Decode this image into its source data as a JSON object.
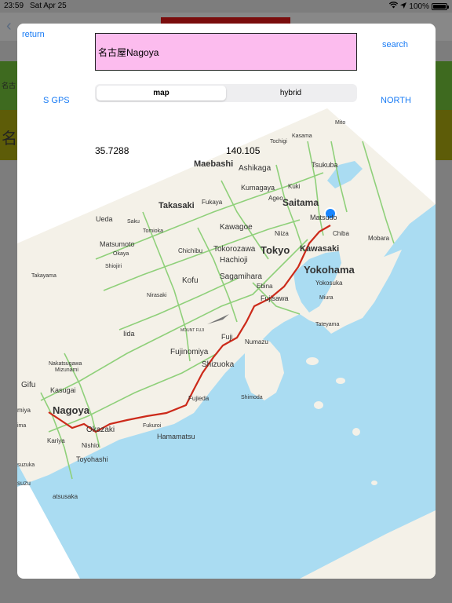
{
  "status_bar": {
    "time": "23:59",
    "date": "Sat Apr 25",
    "battery": "100%",
    "battery_level": 1.0
  },
  "background": {
    "row_small_text": "名古",
    "row_big_text": "名"
  },
  "toolbar": {
    "return_label": "return",
    "search_label": "search",
    "search_value": "名古屋Nagoya",
    "gps_label": "S GPS",
    "north_label": "NORTH"
  },
  "map_type": {
    "options": [
      "map",
      "hybrid"
    ],
    "selected": "map"
  },
  "coordinates": {
    "latitude": "35.7288",
    "longitude": "140.105"
  },
  "map": {
    "colors": {
      "land": "#f4f1e8",
      "water": "#aadcf2",
      "route": "#cc2a1a",
      "location": "#1a86ff"
    },
    "labels": {
      "mito": "Mito",
      "maebashi": "Maebashi",
      "ashikaga": "Ashikaga",
      "tochigi": "Tochigi",
      "kasama": "Kasama",
      "kumagaya": "Kumagaya",
      "takasaki": "Takasaki",
      "fukaya": "Fukaya",
      "tsukuba": "Tsukuba",
      "kuki": "Kuki",
      "saitama": "Saitama",
      "ageo": "Ageo",
      "ueda": "Ueda",
      "saku": "Saku",
      "tomioka": "Tomioka",
      "matsumoto": "Matsumoto",
      "kawagoe": "Kawagoe",
      "matsudo": "Matsudo",
      "tokorozawa": "Tokorozawa",
      "niiza": "Niiza",
      "chiba": "Chiba",
      "chichibu": "Chichibu",
      "hachioji": "Hachioji",
      "tokyo": "Tokyo",
      "kawasaki": "Kawasaki",
      "mobara": "Mobara",
      "okaya": "Okaya",
      "shiojiri": "Shiojiri",
      "takayama": "Takayama",
      "kofu": "Kofu",
      "sagamihara": "Sagamihara",
      "yokohama": "Yokohama",
      "ebina": "Ebina",
      "fujisawa": "Fujisawa",
      "yokosuka": "Yokosuka",
      "nirasaki": "Nirasaki",
      "miura": "Miura",
      "mount_fuji": "MOUNT FUJI",
      "tateyama": "Tateyama",
      "iida": "Iida",
      "fujinomiya": "Fujinomiya",
      "fuji": "Fuji",
      "numazu": "Numazu",
      "nakatsugawa": "Nakatsugawa",
      "mizunami": "Mizunami",
      "shizuoka": "Shizuoka",
      "gifu": "Gifu",
      "kasugai": "Kasugai",
      "shimoda": "Shimoda",
      "nagoya": "Nagoya",
      "fujieda": "Fujieda",
      "okazaki": "Okazaki",
      "fukuroi": "Fukuroi",
      "hamamatsu": "Hamamatsu",
      "kariya": "Kariya",
      "nishio": "Nishio",
      "toyohashi": "Toyohashi",
      "suzuka": "suzuka",
      "matsusaka": "atsusaka",
      "ichinomiya": "miya",
      "ima": "ima",
      "suzu": "suzu"
    }
  }
}
